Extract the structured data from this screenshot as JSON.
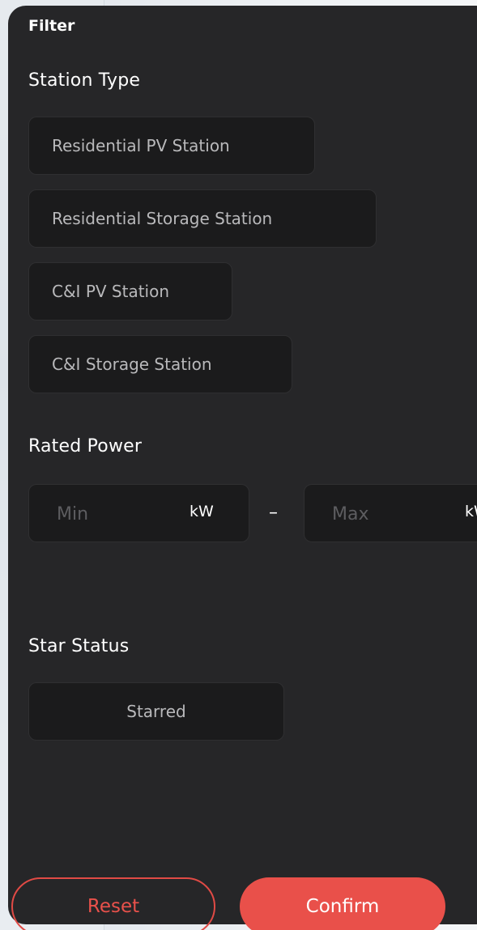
{
  "filter": {
    "title": "Filter",
    "station_type": {
      "heading": "Station Type",
      "options": [
        "Residential PV Station",
        "Residential Storage Station",
        "C&I PV Station",
        "C&I Storage Station"
      ]
    },
    "rated_power": {
      "heading": "Rated Power",
      "min_placeholder": "Min",
      "max_placeholder": "Max",
      "unit": "kW",
      "separator": "–"
    },
    "star_status": {
      "heading": "Star Status",
      "options": [
        "Starred"
      ]
    },
    "actions": {
      "reset": "Reset",
      "confirm": "Confirm"
    },
    "colors": {
      "panel_bg": "#262628",
      "chip_bg": "#1b1b1c",
      "accent": "#e9504a"
    }
  }
}
